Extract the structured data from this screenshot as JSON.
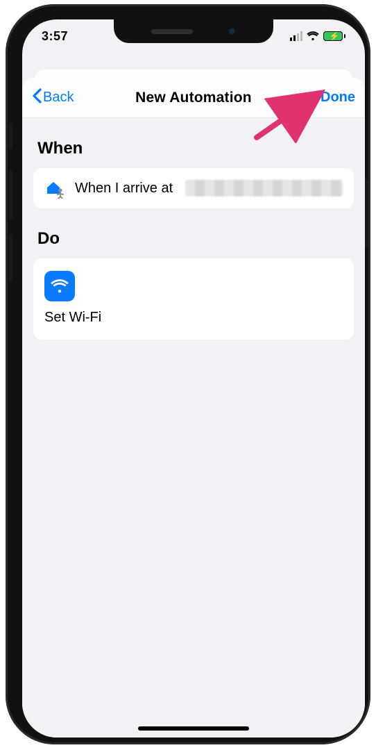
{
  "status": {
    "time": "3:57"
  },
  "navbar": {
    "back_label": "Back",
    "title": "New Automation",
    "done_label": "Done"
  },
  "sections": {
    "when_header": "When",
    "do_header": "Do"
  },
  "when": {
    "text": "When I arrive at",
    "icon": "home-arrive-icon"
  },
  "do": {
    "action_name": "Set Wi-Fi",
    "icon": "wifi-app-icon"
  },
  "colors": {
    "accent": "#007aff",
    "bg": "#f2f2f6"
  }
}
